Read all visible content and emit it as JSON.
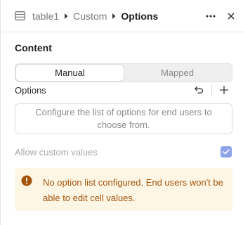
{
  "header": {
    "breadcrumb": [
      "table1",
      "Custom"
    ],
    "current": "Options",
    "icons": {
      "table": "table-icon",
      "more": "more-icon",
      "close": "close-icon"
    }
  },
  "content": {
    "title": "Content",
    "mode_tabs": [
      {
        "label": "Manual",
        "active": true
      },
      {
        "label": "Mapped",
        "active": false
      }
    ]
  },
  "options": {
    "label": "Options",
    "empty_text": "Configure the list of options for end users to choose from."
  },
  "allow_custom": {
    "label": "Allow custom values",
    "checked": true,
    "disabled": true
  },
  "warning": {
    "text": "No option list configured. End users won't be able to edit cell values."
  },
  "colors": {
    "accent": "#8fa4e8",
    "warning_bg": "#fdf6e4",
    "warning_text": "#a3540d"
  }
}
